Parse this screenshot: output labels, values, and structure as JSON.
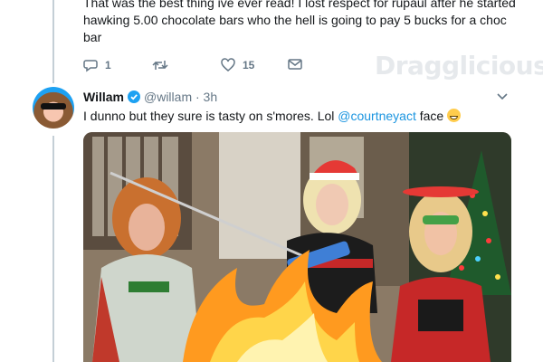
{
  "previous_tweet": {
    "text": "That was the best thing ive ever read!  I lost respect for  rupaul after he started hawking 5.00 chocolate bars  who the hell  is going to pay 5 bucks for a choc bar",
    "reply_count": "1",
    "retweet_count": "",
    "like_count": "15"
  },
  "watermark": "Dragglicious",
  "tweet": {
    "display_name": "Willam",
    "handle_time": "@willam · 3h",
    "text_before": "I dunno but they sure is tasty on s'mores. Lol ",
    "mention": "@courtneyact",
    "text_after": " face ",
    "emoji": "grinning-face-emoji"
  },
  "colors": {
    "accent": "#1da1f2",
    "link": "#1b95e0",
    "muted": "#657786",
    "thread_line": "#c4cfd6"
  },
  "icons": [
    "reply-icon",
    "retweet-icon",
    "like-icon",
    "direct-message-icon",
    "verified-badge-icon",
    "chevron-down-icon"
  ]
}
